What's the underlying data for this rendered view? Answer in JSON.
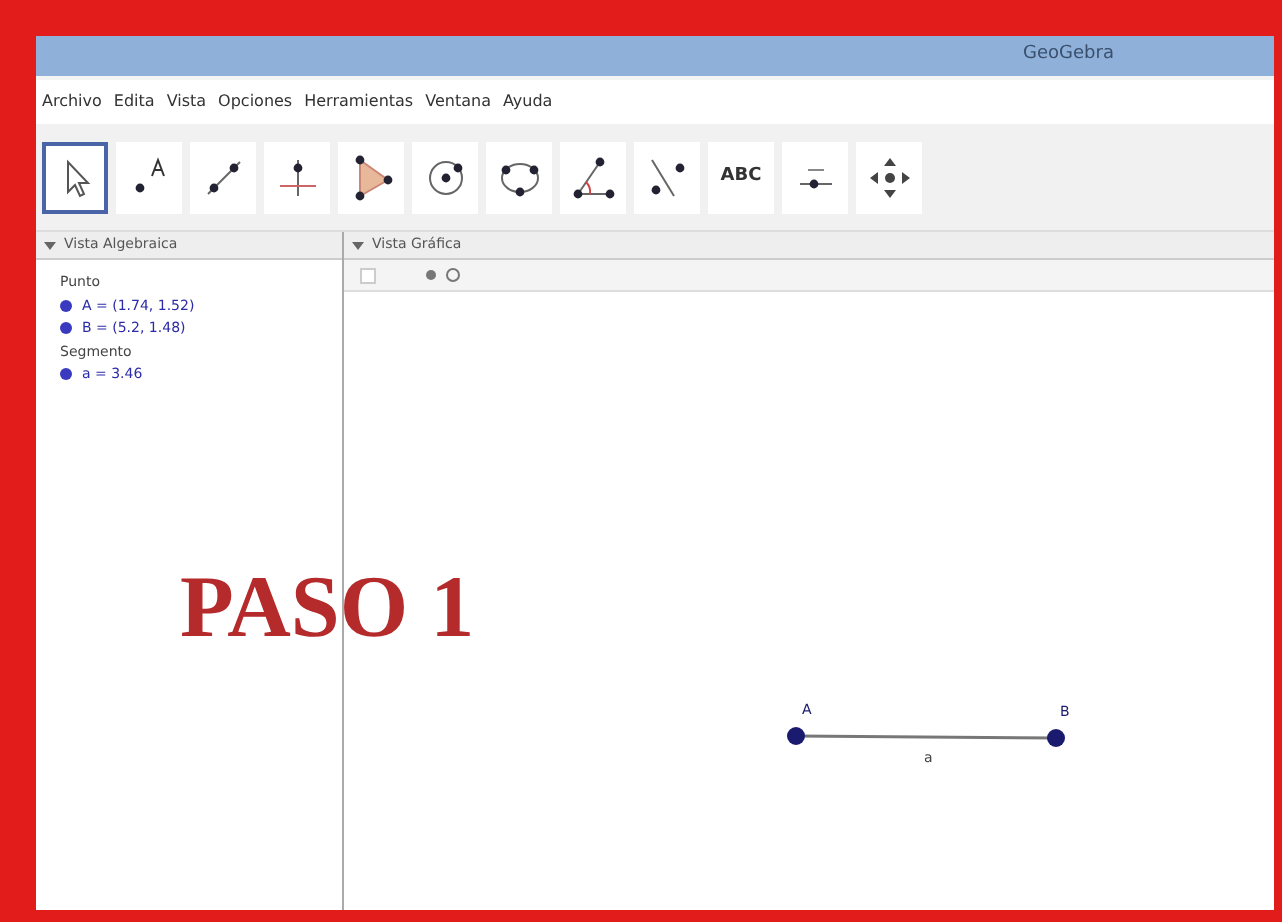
{
  "window": {
    "title": "GeoGebra"
  },
  "menu": [
    "Archivo",
    "Edita",
    "Vista",
    "Opciones",
    "Herramientas",
    "Ventana",
    "Ayuda"
  ],
  "tools": [
    {
      "kind": "move",
      "selected": true
    },
    {
      "kind": "point",
      "selected": false
    },
    {
      "kind": "line",
      "selected": false
    },
    {
      "kind": "perpendicular",
      "selected": false
    },
    {
      "kind": "polygon",
      "selected": false
    },
    {
      "kind": "circle",
      "selected": false
    },
    {
      "kind": "conic",
      "selected": false
    },
    {
      "kind": "angle",
      "selected": false
    },
    {
      "kind": "reflect",
      "selected": false
    },
    {
      "kind": "text",
      "label": "ABC",
      "selected": false
    },
    {
      "kind": "slider",
      "selected": false
    },
    {
      "kind": "pan",
      "selected": false
    }
  ],
  "algebra_view": {
    "title": "Vista Algebraica",
    "groups": [
      {
        "heading": "Punto",
        "items": [
          "A = (1.74, 1.52)",
          "B = (5.2, 1.48)"
        ]
      },
      {
        "heading": "Segmento",
        "items": [
          "a = 3.46"
        ]
      }
    ]
  },
  "graphics_view": {
    "title": "Vista Gráfica",
    "points": [
      "A",
      "B"
    ],
    "segment_label": "a"
  },
  "overlay": "PASO 1"
}
